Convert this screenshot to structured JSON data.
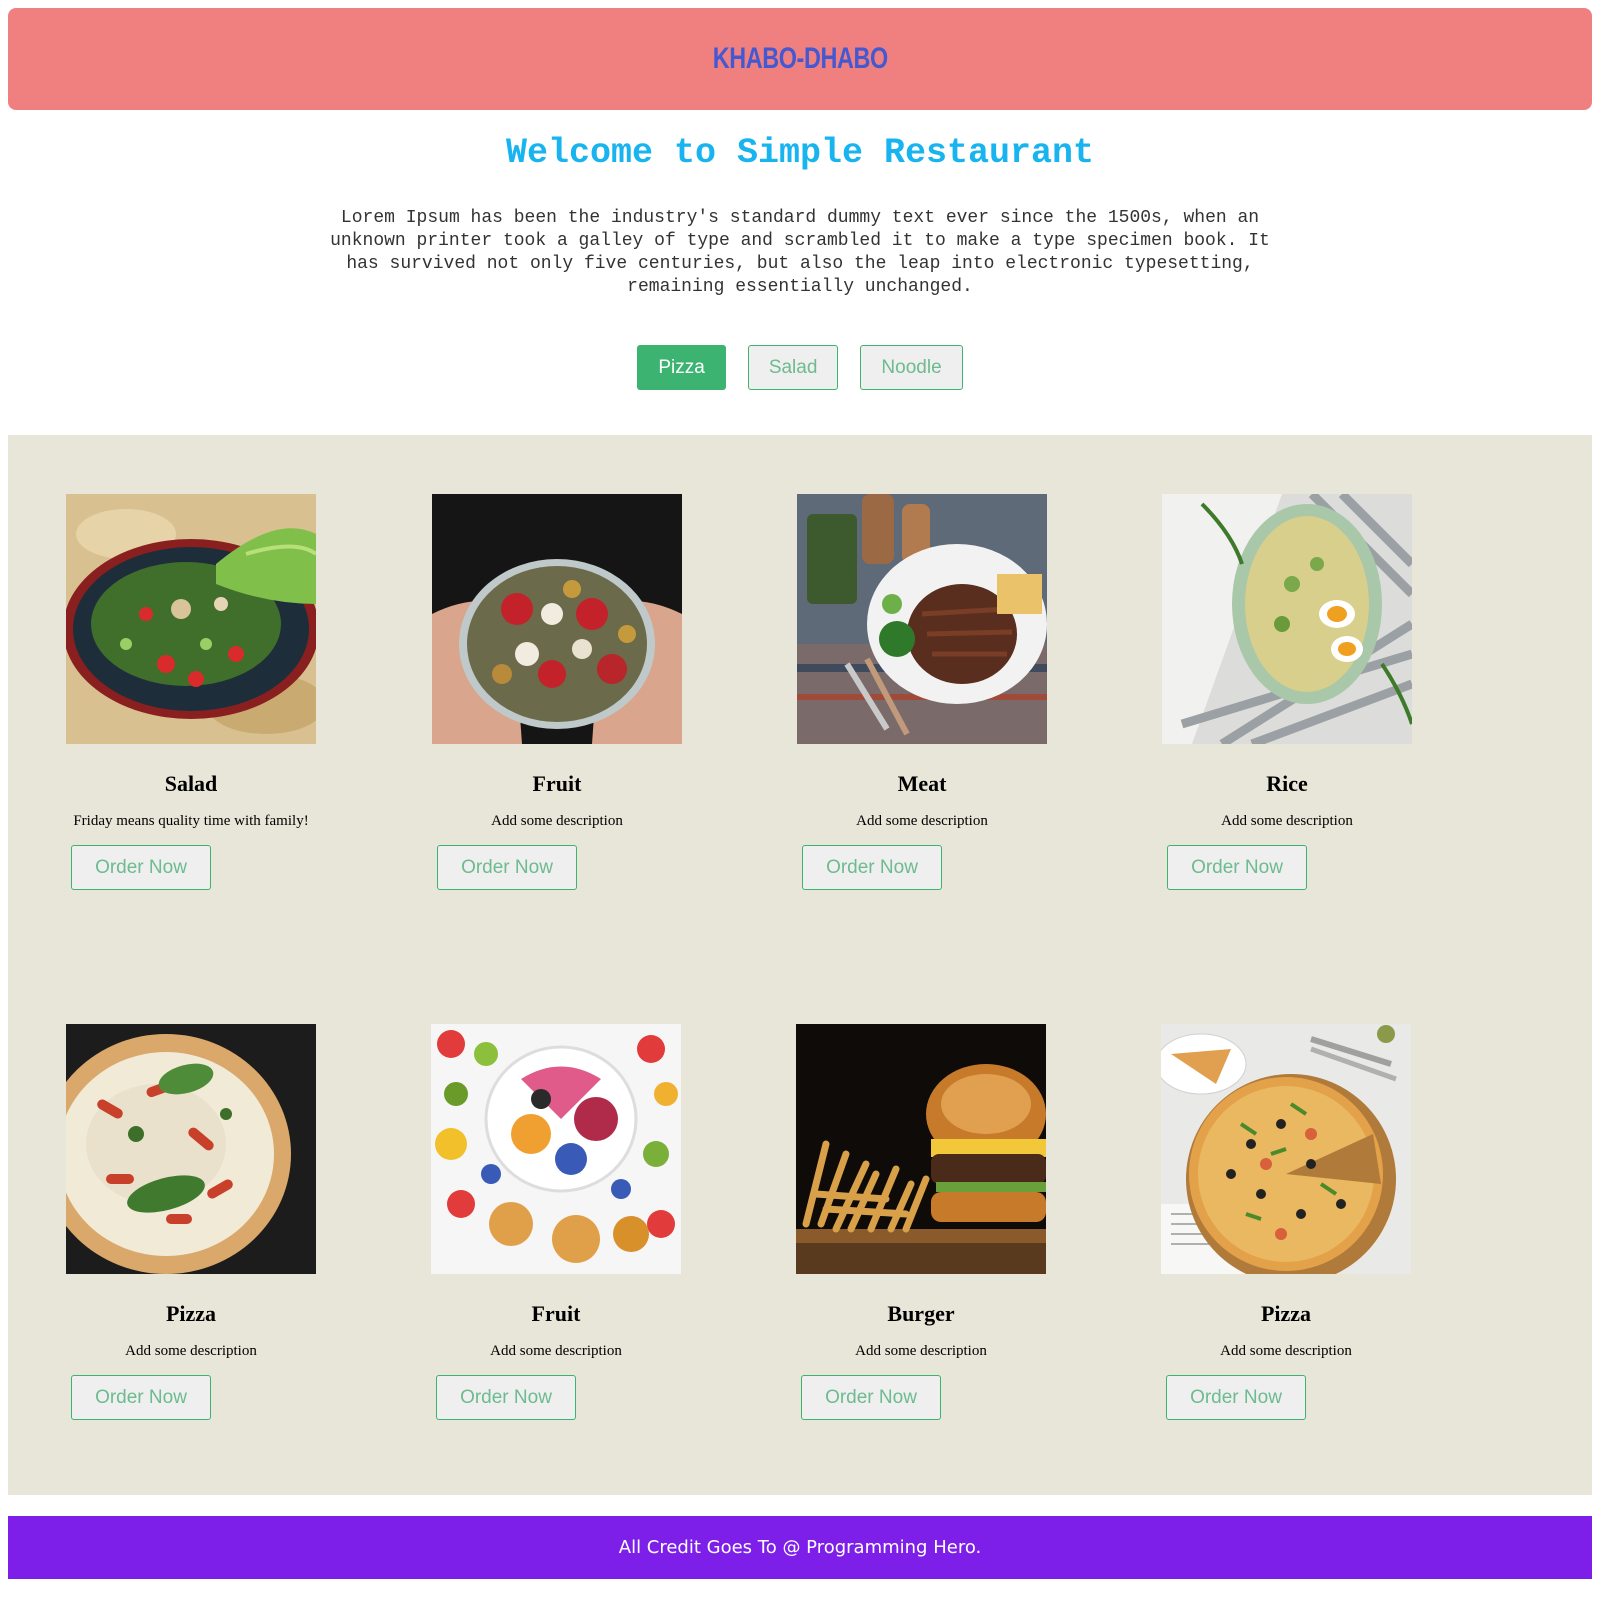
{
  "header": {
    "brand": "KHABO-DHABO"
  },
  "hero": {
    "title": "Welcome to Simple Restaurant",
    "intro": "Lorem Ipsum has been the industry's standard dummy text ever since the 1500s, when an unknown printer took a galley of type and scrambled it to make a type specimen book. It has survived not only five centuries, but also the leap into electronic typesetting, remaining essentially unchanged."
  },
  "filters": [
    {
      "label": "Pizza",
      "active": true
    },
    {
      "label": "Salad",
      "active": false
    },
    {
      "label": "Noodle",
      "active": false
    }
  ],
  "menu": [
    {
      "title": "Salad",
      "desc": "Friday means quality time with family!",
      "button": "Order Now",
      "image": "salad-bowl-image"
    },
    {
      "title": "Fruit",
      "desc": "Add some description",
      "button": "Order Now",
      "image": "fruit-bowl-image"
    },
    {
      "title": "Meat",
      "desc": "Add some description",
      "button": "Order Now",
      "image": "steak-plate-image"
    },
    {
      "title": "Rice",
      "desc": "Add some description",
      "button": "Order Now",
      "image": "rice-plate-image"
    },
    {
      "title": "Pizza",
      "desc": "Add some description",
      "button": "Order Now",
      "image": "pizza-basil-image"
    },
    {
      "title": "Fruit",
      "desc": "Add some description",
      "button": "Order Now",
      "image": "fruit-smoothie-bowl-image"
    },
    {
      "title": "Burger",
      "desc": "Add some description",
      "button": "Order Now",
      "image": "burger-fries-image"
    },
    {
      "title": "Pizza",
      "desc": "Add some description",
      "button": "Order Now",
      "image": "pizza-board-image"
    }
  ],
  "footer": {
    "credit": "All Credit Goes To @ Programming Hero."
  },
  "colors": {
    "header_bg": "#f08080",
    "brand": "#4458d1",
    "title": "#18b4f0",
    "accent_green": "#3cb371",
    "section_bg": "#e8e6d8",
    "footer_bg": "#7e1fe9"
  }
}
